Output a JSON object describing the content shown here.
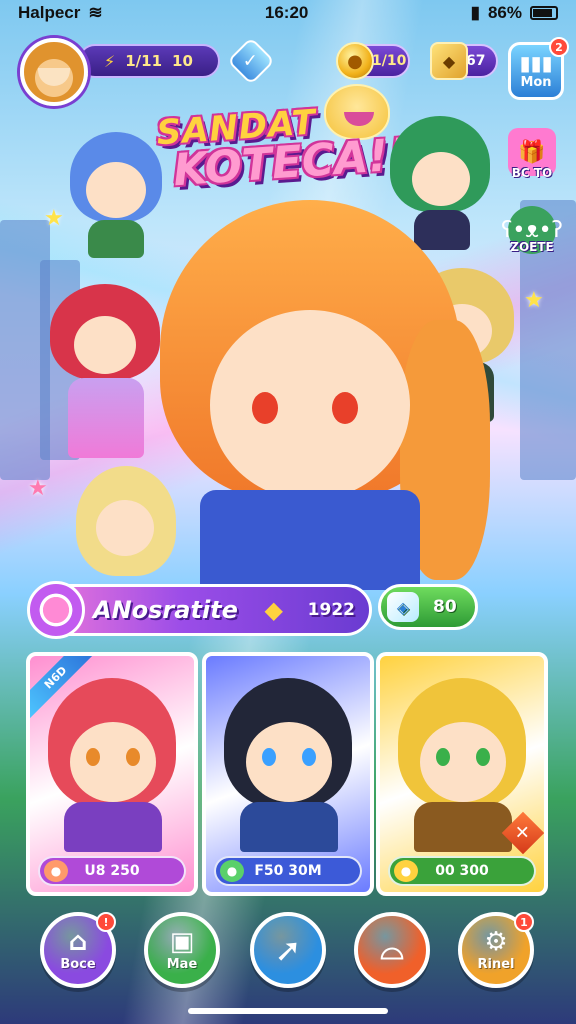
{
  "status_bar": {
    "carrier": "Halpecr",
    "time": "16:20",
    "battery": "86%",
    "battery_level": 0.86
  },
  "hud": {
    "level_value": "1/11",
    "level_extra": "10",
    "coins": "1/10",
    "gems": "67",
    "menu_label": "Mon",
    "menu_badge": "2"
  },
  "title": {
    "line1": "SANDAT",
    "line2": "KOTECA!!"
  },
  "side_events": [
    {
      "label": "BC TO",
      "icon": "gift-icon",
      "color": "#ff7ad0"
    },
    {
      "label": "ZOETE",
      "icon": "bear-icon",
      "color": "#3aa25e"
    }
  ],
  "event_banner": {
    "name": "ANosratite",
    "count": "1922"
  },
  "reward": {
    "value": "80"
  },
  "cards": [
    {
      "ribbon": "N6D",
      "price": "U8 250",
      "price_color": "#b04ad8",
      "frame": "#ff8fd0",
      "hair": "#e64a5a",
      "eyes": "#e88a2a",
      "outfit": "#7a3fc0"
    },
    {
      "ribbon": "",
      "price": "F50 30M",
      "price_color": "#3c5ad8",
      "frame": "#6a7bff",
      "hair": "#222638",
      "eyes": "#3aa0ff",
      "outfit": "#2c4a9a"
    },
    {
      "ribbon": "",
      "price": "00 300",
      "price_color": "#3aa23a",
      "frame": "#ffd23f",
      "hair": "#f0c43a",
      "eyes": "#3ab04a",
      "outfit": "#8a5a20"
    }
  ],
  "nav": [
    {
      "label": "Boce",
      "icon": "house-icon",
      "color": "#8a4ae0",
      "badge": "!"
    },
    {
      "label": "Mae",
      "icon": "cards-icon",
      "color": "#3ab04a",
      "badge": ""
    },
    {
      "label": "",
      "icon": "arrow-icon",
      "color": "#2c8fe0",
      "badge": ""
    },
    {
      "label": "",
      "icon": "bell-icon",
      "color": "#f0602a",
      "badge": ""
    },
    {
      "label": "Rinel",
      "icon": "gear-icon",
      "color": "#f0a22a",
      "badge": "1"
    }
  ],
  "colors": {
    "accent_purple": "#5b3ab8",
    "gold": "#ffd23f",
    "pink": "#f27ad9"
  }
}
